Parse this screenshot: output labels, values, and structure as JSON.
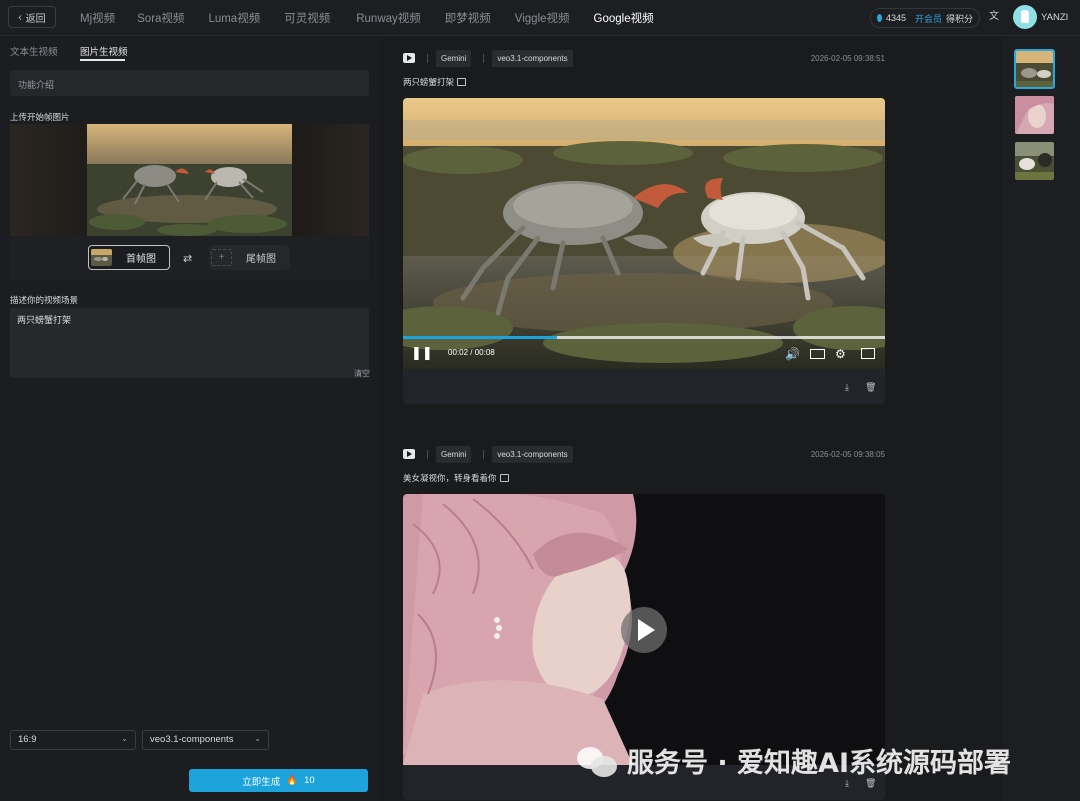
{
  "nav": {
    "back_label": "返回",
    "tabs": [
      "Mj视频",
      "Sora视频",
      "Luma视频",
      "可灵视频",
      "Runway视频",
      "即梦视频",
      "Viggle视频",
      "Google视频"
    ],
    "active_tab": "Google视频",
    "points": "4345",
    "vip_label": "开会员",
    "credit_label": "得积分",
    "username": "YANZI"
  },
  "left": {
    "sub_tabs": [
      "文本生视频",
      "图片生视频"
    ],
    "active_sub_tab": "图片生视频",
    "intro": "功能介绍",
    "upload_title": "上传开始帧图片",
    "first_frame_label": "首帧图",
    "last_frame_label": "尾帧图",
    "desc_title": "描述你的视频场景",
    "desc_value": "两只螃蟹打架",
    "clear_label": "清空",
    "ratio": "16:9",
    "model": "veo3.1-components",
    "generate_label": "立即生成",
    "generate_cost": "10"
  },
  "feed": [
    {
      "provider": "Gemini",
      "model": "veo3.1-components",
      "time": "2026-02-05 09:38:51",
      "prompt": "两只螃蟹打架",
      "current_time": "00:02",
      "duration": "00:08",
      "progress": 0.32
    },
    {
      "provider": "Gemini",
      "model": "veo3.1-components",
      "time": "2026-02-05 09:38:05",
      "prompt": "美女凝视你，转身看着你"
    }
  ],
  "watermark": "服务号 · 爱知趣AI系统源码部署",
  "colors": {
    "accent": "#1ca3dc",
    "background": "#1a1b1d",
    "panel": "#1c1d20"
  }
}
